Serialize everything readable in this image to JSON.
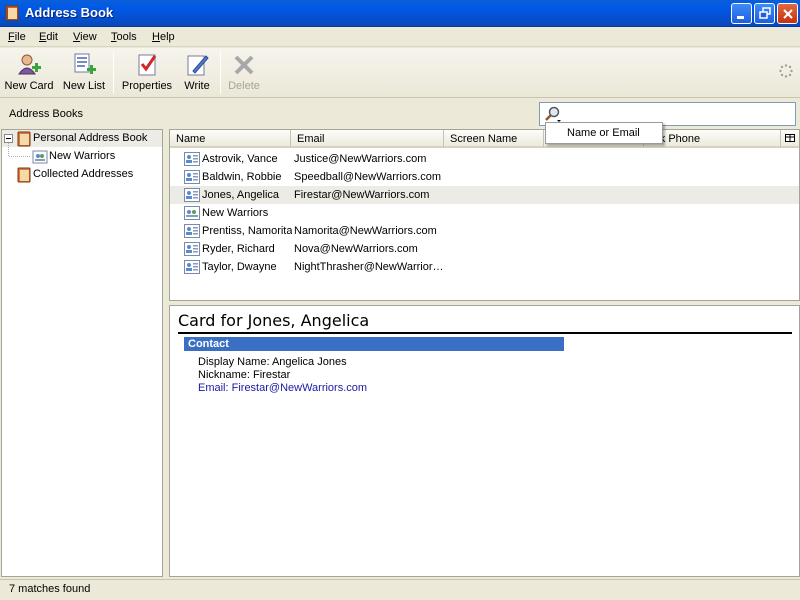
{
  "window": {
    "title": "Address Book"
  },
  "menu": [
    {
      "label": "File",
      "key": "F",
      "rest": "ile"
    },
    {
      "label": "Edit",
      "key": "E",
      "rest": "dit"
    },
    {
      "label": "View",
      "key": "V",
      "rest": "iew"
    },
    {
      "label": "Tools",
      "key": "T",
      "rest": "ools"
    },
    {
      "label": "Help",
      "key": "H",
      "rest": "elp"
    }
  ],
  "toolbar": {
    "new_card": "New Card",
    "new_list": "New List",
    "properties": "Properties",
    "write": "Write",
    "delete": "Delete"
  },
  "search": {
    "section_label": "Address Books",
    "value": "",
    "dropdown_option": "Name or Email"
  },
  "tree": {
    "personal": "Personal Address Book",
    "list": "New Warriors",
    "collected": "Collected Addresses"
  },
  "columns": {
    "name": "Name",
    "email": "Email",
    "screen_name": "Screen Name",
    "work_phone": "ork Phone"
  },
  "contacts": [
    {
      "name": "Astrovik, Vance",
      "email": "Justice@NewWarriors.com"
    },
    {
      "name": "Baldwin, Robbie",
      "email": "Speedball@NewWarriors.com"
    },
    {
      "name": "Jones, Angelica",
      "email": "Firestar@NewWarriors.com"
    },
    {
      "name": "New Warriors",
      "email": ""
    },
    {
      "name": "Prentiss, Namorita",
      "email": "Namorita@NewWarriors.com"
    },
    {
      "name": "Ryder, Richard",
      "email": "Nova@NewWarriors.com"
    },
    {
      "name": "Taylor, Dwayne",
      "email": "NightThrasher@NewWarrior…"
    }
  ],
  "selected_index": 2,
  "card": {
    "title": "Card for Jones, Angelica",
    "section": "Contact",
    "display_name": "Display Name: Angelica Jones",
    "nickname": "Nickname: Firestar",
    "email": "Email: Firestar@NewWarriors.com"
  },
  "status": {
    "text": "7 matches found"
  },
  "colors": {
    "titlebar": "#0058e6",
    "contact_bar": "#3a6fc3",
    "selection": "#ecebe5",
    "email_link": "#1a1aa6"
  }
}
